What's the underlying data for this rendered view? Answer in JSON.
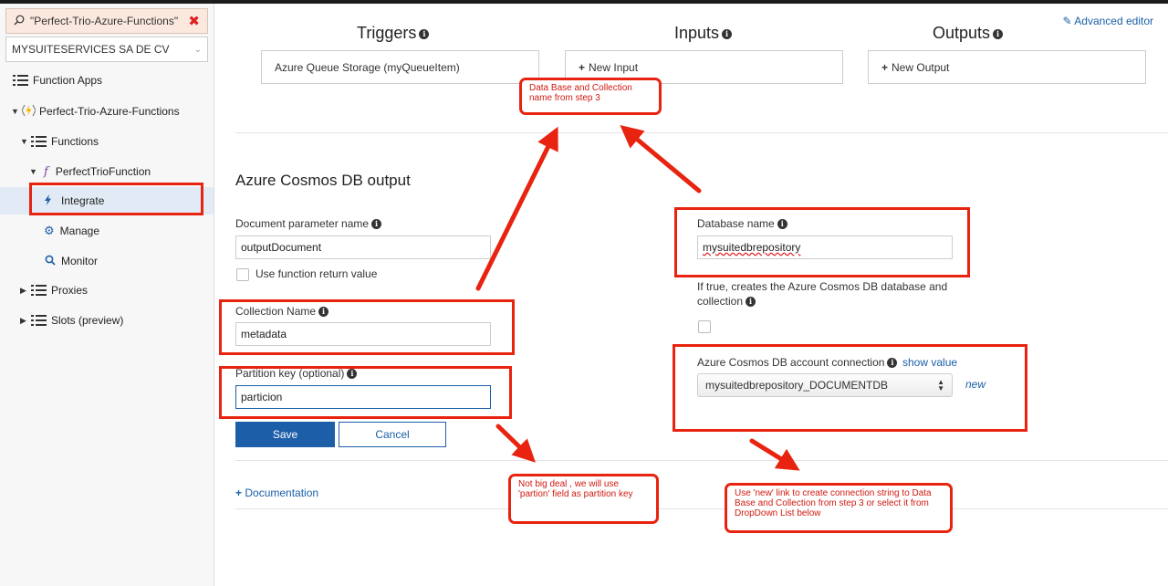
{
  "sidebar": {
    "search_text": "\"Perfect-Trio-Azure-Functions\"",
    "subscription": "MYSUITESERVICES SA DE CV",
    "items": [
      {
        "label": "Function Apps"
      },
      {
        "label": "Perfect-Trio-Azure-Functions"
      },
      {
        "label": "Functions"
      },
      {
        "label": "PerfectTrioFunction"
      },
      {
        "label": "Integrate"
      },
      {
        "label": "Manage"
      },
      {
        "label": "Monitor"
      },
      {
        "label": "Proxies"
      },
      {
        "label": "Slots (preview)"
      }
    ]
  },
  "header": {
    "advanced_editor": "Advanced editor",
    "triggers_title": "Triggers",
    "inputs_title": "Inputs",
    "outputs_title": "Outputs",
    "trigger_item": "Azure Queue Storage (myQueueItem)",
    "new_input": "New Input",
    "new_output": "New Output"
  },
  "form": {
    "section_title": "Azure Cosmos DB output",
    "doc_param_label": "Document parameter name",
    "doc_param_value": "outputDocument",
    "use_return_label": "Use function return value",
    "collection_label": "Collection Name",
    "collection_value": "metadata",
    "partition_label": "Partition key (optional)",
    "partition_value": "particion",
    "save_label": "Save",
    "cancel_label": "Cancel",
    "database_label": "Database name",
    "database_value": "mysuitedbrepository",
    "create_if_label": "If true, creates the Azure Cosmos DB database and collection",
    "account_label": "Azure Cosmos DB account connection",
    "show_value": "show value",
    "account_value": "mysuitedbrepository_DOCUMENTDB",
    "new_link": "new",
    "documentation": "Documentation"
  },
  "annotations": {
    "step3": "Data Base and Collection name from step 3",
    "partition_note": "Not big deal , we will use 'partion' field as partition key",
    "new_note": "Use 'new' link to create connection string to Data Base and Collection from step 3 or select it from DropDown List below"
  },
  "colors": {
    "accent": "#1c5fa8",
    "annotation_red": "#e8230f",
    "selected_bg": "#e2ebf5"
  }
}
